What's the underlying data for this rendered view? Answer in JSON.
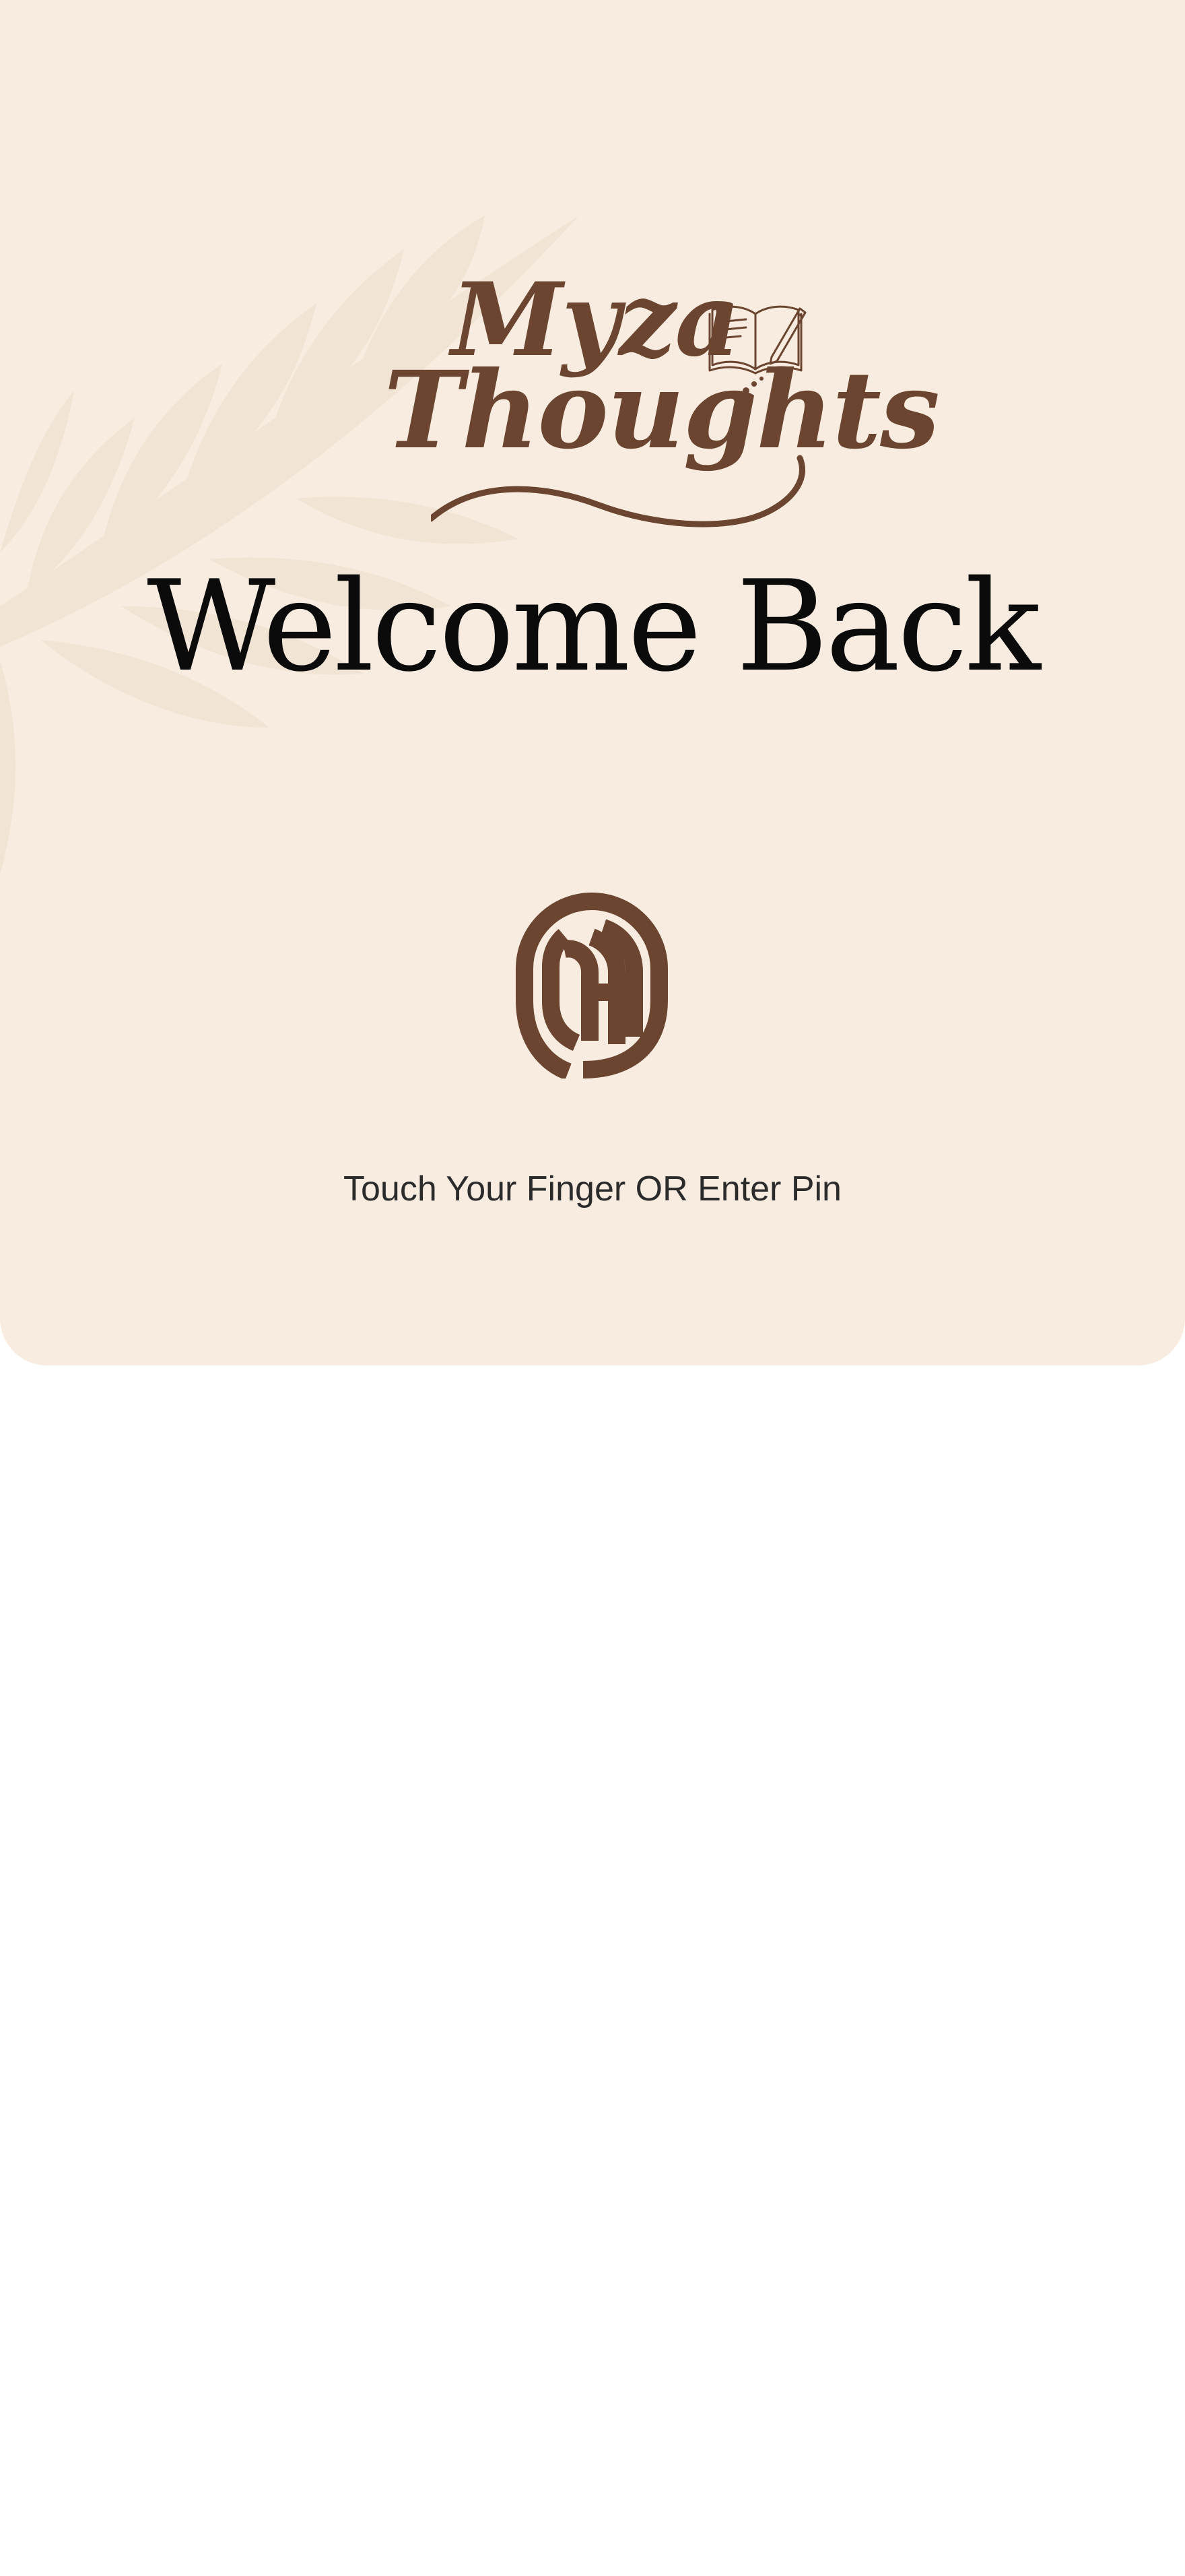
{
  "brand": {
    "line1": "Myza",
    "line2": "Thoughts",
    "logo_icon": "open-book-pencil-icon",
    "color": "#6b4530"
  },
  "title": "Welcome Back",
  "biometric": {
    "icon": "fingerprint-icon",
    "color": "#6b4530"
  },
  "prompt": "Touch Your Finger OR Enter Pin",
  "colors": {
    "panel_background": "#f7ecdf",
    "page_background": "#ffffff",
    "title_text": "#0b0b0b",
    "body_text": "#2b2b2b"
  }
}
